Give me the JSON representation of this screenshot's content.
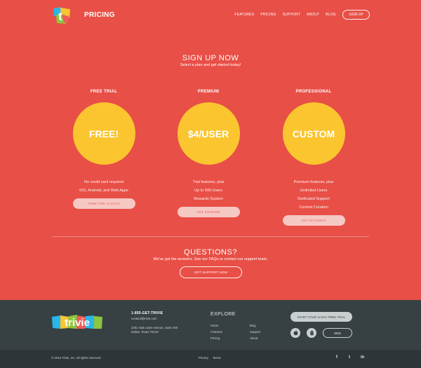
{
  "header": {
    "title": "PRICING",
    "nav": [
      "FEATURES",
      "PRICING",
      "SUPPORT",
      "ABOUT",
      "BLOG"
    ],
    "signup_label": "SIGN UP"
  },
  "hero": {
    "title": "SIGN UP NOW",
    "subtitle": "Select a plan and get started today!"
  },
  "plans": [
    {
      "name": "FREE TRIAL",
      "price": "FREE!",
      "features": [
        "No credit card required",
        "iOS, Android, and Web Apps"
      ],
      "button": "FREE FOR 14 DAYS"
    },
    {
      "name": "PREMIUM",
      "price": "$4/USER",
      "features": [
        "Trial features, plus",
        "Up to 500 Users",
        "Rewards System"
      ],
      "button": "GET STARTED"
    },
    {
      "name": "PROFESSIONAL",
      "price": "CUSTOM",
      "features": [
        "Premium features, plus",
        "Unlimited Users",
        "Dedicated Support",
        "Content Curation"
      ],
      "button": "GET IN TOUCH"
    }
  ],
  "questions": {
    "title": "QUESTIONS?",
    "subtitle": "We've got the answers. See our FAQs or contact our support team.",
    "button": "GET SUPPORT NOW"
  },
  "footer": {
    "logo_text": "trivie",
    "phone": "1-855-GET-TRIVIE",
    "email": "contact@trivie.com",
    "address_line1": "2201 Oak Lawn Avenue, Suite 300",
    "address_line2": "Dallas, Texas 75219",
    "explore_title": "EXPLORE",
    "explore_col1": [
      "Home",
      "Features",
      "Pricing"
    ],
    "explore_col2": [
      "Blog",
      "Support",
      "About"
    ],
    "trial_button": "START YOUR 14 DAY FREE TRIAL",
    "web_button": "WEB",
    "copyright": "© 2015 Trivie, Inc. All rights reserved.",
    "privacy": "Privacy",
    "terms": "Terms",
    "social": [
      "f",
      "t",
      "in"
    ]
  },
  "colors": {
    "background": "#e84f46",
    "accent_yellow": "#fbc52f",
    "footer_dark": "#374043",
    "footer_darker": "#2d3538"
  },
  "icons": [
    "apple-icon",
    "android-icon",
    "facebook-icon",
    "twitter-icon",
    "linkedin-icon"
  ]
}
